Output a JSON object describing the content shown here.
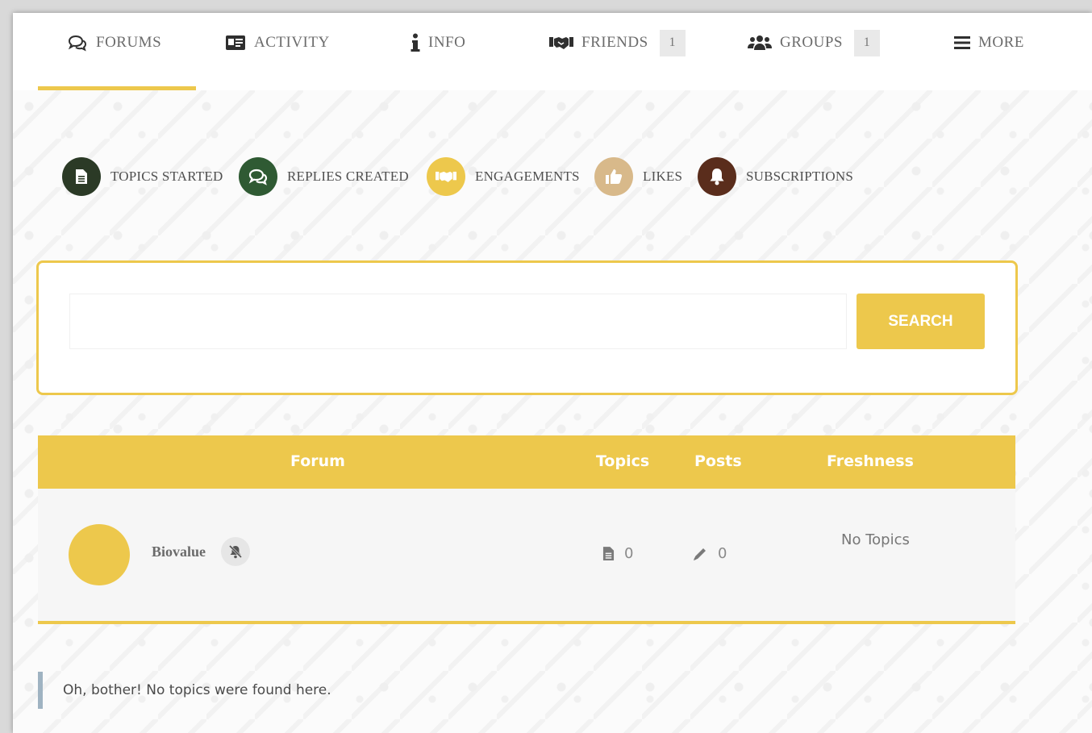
{
  "topnav": {
    "items": [
      {
        "label": "FORUMS",
        "icon": "chat-bubbles-icon"
      },
      {
        "label": "ACTIVITY",
        "icon": "id-card-icon"
      },
      {
        "label": "INFO",
        "icon": "info-icon"
      },
      {
        "label": "FRIENDS",
        "icon": "handshake-icon",
        "count": "1"
      },
      {
        "label": "GROUPS",
        "icon": "users-icon",
        "count": "1"
      },
      {
        "label": "MORE",
        "icon": "hamburger-icon"
      }
    ],
    "active": "FORUMS"
  },
  "subtabs": [
    {
      "label": "TOPICS STARTED",
      "icon": "document-icon",
      "color": "#2b3a26"
    },
    {
      "label": "REPLIES CREATED",
      "icon": "chat-bubbles-icon",
      "color": "#2f5a33"
    },
    {
      "label": "ENGAGEMENTS",
      "icon": "handshake-icon",
      "color": "#edc84c"
    },
    {
      "label": "LIKES",
      "icon": "thumbs-up-icon",
      "color": "#d8b98a"
    },
    {
      "label": "SUBSCRIPTIONS",
      "icon": "bell-icon",
      "color": "#5a2d1c"
    }
  ],
  "search": {
    "placeholder": "",
    "value": "",
    "button_label": "SEARCH"
  },
  "table": {
    "headers": {
      "forum": "Forum",
      "topics": "Topics",
      "posts": "Posts",
      "freshness": "Freshness"
    },
    "rows": [
      {
        "name": "Biovalue",
        "topics": "0",
        "posts": "0",
        "freshness": "No Topics"
      }
    ]
  },
  "notice": "Oh, bother! No topics were found here.",
  "colors": {
    "accent": "#edc84c",
    "notice_border": "#9fb3c2"
  }
}
